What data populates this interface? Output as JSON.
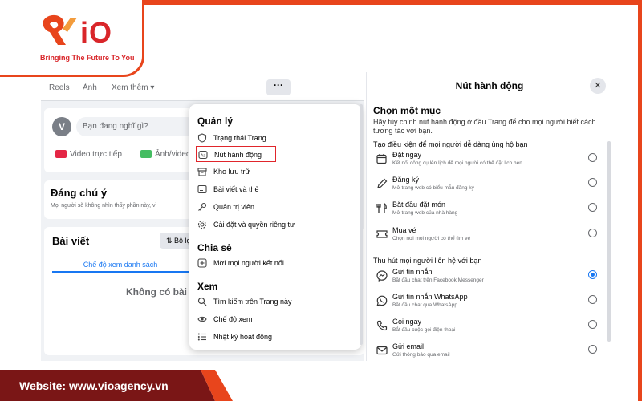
{
  "brand": {
    "logo_text": "iO",
    "tagline": "Bringing The Future To You",
    "website_text": "Website: www.vioagency.vn",
    "colors": {
      "primary": "#e8451c",
      "red": "#d9262a",
      "footer_dark": "#7a1616"
    }
  },
  "fb": {
    "tabs": [
      "Reels",
      "Ảnh",
      "Xem thêm ▾"
    ],
    "more_button": "···",
    "composer": {
      "avatar_letter": "V",
      "placeholder": "Bạn đang nghĩ gì?",
      "live_video_label": "Video trực tiếp",
      "photo_video_label": "Ảnh/video"
    },
    "notable": {
      "title": "Đáng chú ý",
      "desc": "Mọi người sẽ không nhìn thấy phần này, vì"
    },
    "posts": {
      "title": "Bài viết",
      "filter_label": "Bộ lọc",
      "list_view_tab": "Chế độ xem danh sách",
      "empty_text": "Không có bài viết"
    }
  },
  "menu": {
    "manage_title": "Quản lý",
    "manage_items": [
      {
        "label": "Trạng thái Trang",
        "icon": "shield-icon"
      },
      {
        "label": "Nút hành động",
        "icon": "action-button-icon"
      },
      {
        "label": "Kho lưu trữ",
        "icon": "archive-icon"
      },
      {
        "label": "Bài viết và thẻ",
        "icon": "posts-tags-icon"
      },
      {
        "label": "Quản trị viên",
        "icon": "admin-key-icon"
      },
      {
        "label": "Cài đặt và quyền riêng tư",
        "icon": "gear-icon"
      }
    ],
    "share_title": "Chia sẻ",
    "share_items": [
      {
        "label": "Mời mọi người kết nối",
        "icon": "invite-icon"
      }
    ],
    "view_title": "Xem",
    "view_items": [
      {
        "label": "Tìm kiếm trên Trang này",
        "icon": "search-icon"
      },
      {
        "label": "Chế độ xem",
        "icon": "eye-icon"
      },
      {
        "label": "Nhật ký hoạt động",
        "icon": "activity-log-icon"
      }
    ]
  },
  "panel": {
    "title": "Nút hành động",
    "close": "✕",
    "choose_title": "Chọn một mục",
    "choose_desc": "Hãy tùy chỉnh nút hành động ở đầu Trang để cho mọi người biết cách tương tác với bạn.",
    "group1_title": "Tạo điều kiện để mọi người dễ dàng ủng hộ bạn",
    "group1": [
      {
        "label": "Đặt ngay",
        "desc": "Kết nối công cụ lên lịch để mọi người có thể đặt lịch hẹn",
        "icon": "calendar-booking-icon",
        "selected": false
      },
      {
        "label": "Đăng ký",
        "desc": "Mở trang web có biểu mẫu đăng ký",
        "icon": "pencil-icon",
        "selected": false
      },
      {
        "label": "Bắt đầu đặt món",
        "desc": "Mở trang web của nhà hàng",
        "icon": "utensils-icon",
        "selected": false
      },
      {
        "label": "Mua vé",
        "desc": "Chọn nơi mọi người có thể tìm vé",
        "icon": "ticket-icon",
        "selected": false
      }
    ],
    "group2_title": "Thu hút mọi người liên hệ với bạn",
    "group2": [
      {
        "label": "Gửi tin nhắn",
        "desc": "Bắt đầu chat trên Facebook Messenger",
        "icon": "messenger-icon",
        "selected": true
      },
      {
        "label": "Gửi tin nhắn WhatsApp",
        "desc": "Bắt đầu chat qua WhatsApp",
        "icon": "whatsapp-icon",
        "selected": false
      },
      {
        "label": "Gọi ngay",
        "desc": "Bắt đầu cuộc gọi điện thoại",
        "icon": "phone-icon",
        "selected": false
      },
      {
        "label": "Gửi email",
        "desc": "Gửi thông báo qua email",
        "icon": "email-icon",
        "selected": false
      }
    ]
  }
}
